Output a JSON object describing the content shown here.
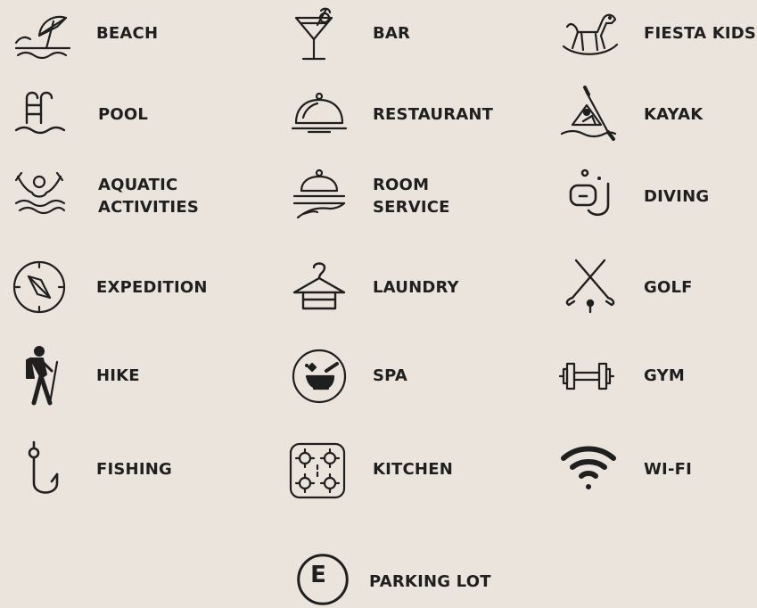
{
  "amenities": {
    "beach": "BEACH",
    "bar": "BAR",
    "fiesta_kids": "FIESTA KIDS",
    "pool": "POOL",
    "restaurant": "RESTAURANT",
    "kayak": "KAYAK",
    "aquatic_line1": "AQUATIC",
    "aquatic_line2": "ACTIVITIES",
    "room_line1": "ROOM",
    "room_line2": "SERVICE",
    "diving": "DIVING",
    "expedition": "EXPEDITION",
    "laundry": "LAUNDRY",
    "golf": "GOLF",
    "hike": "HIKE",
    "spa": "SPA",
    "gym": "GYM",
    "fishing": "FISHING",
    "kitchen": "KITCHEN",
    "wifi": "WI-FI",
    "parking_icon_letter": "E",
    "parking": "PARKING LOT"
  },
  "colors": {
    "background": "#ebe4dd",
    "ink": "#1f1f1f"
  },
  "icons": [
    "beach-umbrella-icon",
    "cocktail-icon",
    "rocking-horse-icon",
    "pool-ladder-icon",
    "cloche-icon",
    "kayak-icon",
    "swimmer-icon",
    "room-service-icon",
    "snorkel-icon",
    "compass-icon",
    "hanger-icon",
    "golf-clubs-icon",
    "hiker-icon",
    "spa-mortar-icon",
    "dumbbell-icon",
    "fish-hook-icon",
    "stove-icon",
    "wifi-icon",
    "parking-icon"
  ]
}
